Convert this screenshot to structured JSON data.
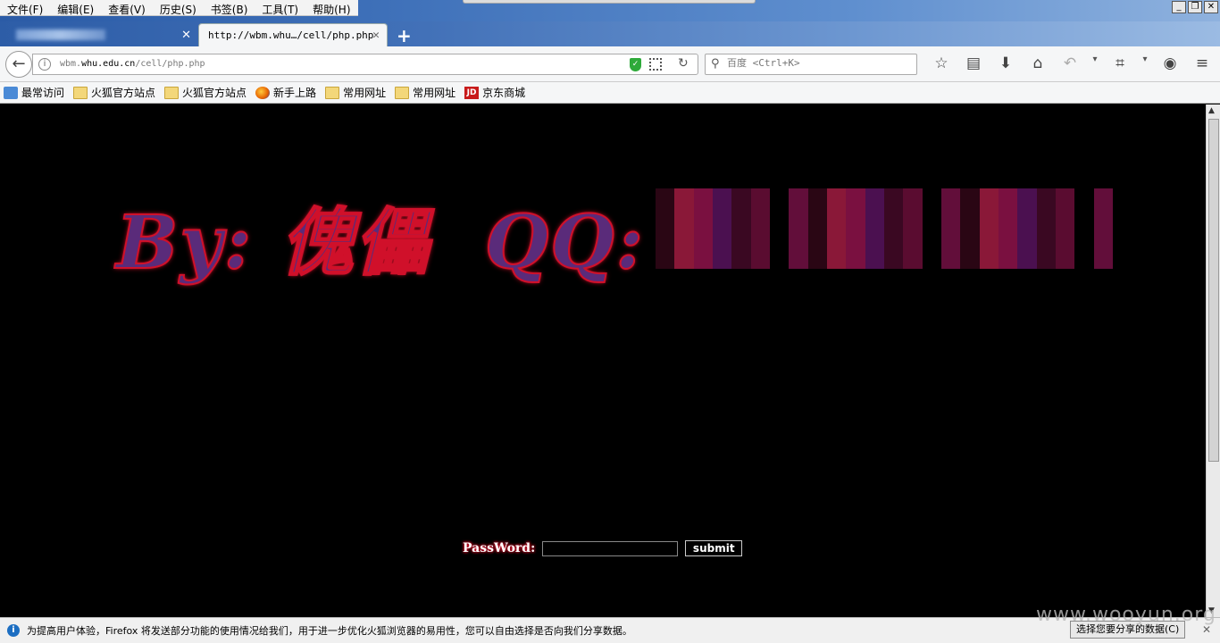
{
  "menu": [
    "文件(F)",
    "编辑(E)",
    "查看(V)",
    "历史(S)",
    "书签(B)",
    "工具(T)",
    "帮助(H)"
  ],
  "window_controls": [
    "_",
    "❐",
    "✕"
  ],
  "tabs": {
    "inactive_close": "✕",
    "active_title": "http://wbm.whu…/cell/php.php",
    "active_close": "✕",
    "new_tab": "+"
  },
  "nav": {
    "back": "←",
    "url_prefix": "wbm.",
    "url_domain": "whu.edu.cn",
    "url_path": "/cell/php.php",
    "search_placeholder": "百度 <Ctrl+K>"
  },
  "toolbar_icons": [
    "bookmark-star-icon",
    "reading-list-icon",
    "download-icon",
    "home-icon",
    "undo-icon",
    "dropdown-icon",
    "crop-icon",
    "dropdown-icon",
    "chat-icon",
    "menu-icon"
  ],
  "bookmarks": [
    {
      "label": "最常访问",
      "icon": "most-visited-icon"
    },
    {
      "label": "火狐官方站点",
      "icon": "folder-icon"
    },
    {
      "label": "火狐官方站点",
      "icon": "folder-icon"
    },
    {
      "label": "新手上路",
      "icon": "firefox-icon"
    },
    {
      "label": "常用网址",
      "icon": "folder-icon"
    },
    {
      "label": "常用网址",
      "icon": "folder-icon"
    },
    {
      "label": "京东商城",
      "icon": "jd-icon",
      "badge": "JD"
    }
  ],
  "page": {
    "banner": "By: 傀儡  QQ:",
    "password_label": "PassWord:",
    "submit_label": "submit"
  },
  "notification": {
    "message": "为提高用户体验，Firefox 将发送部分功能的使用情况给我们，用于进一步优化火狐浏览器的易用性，您可以自由选择是否向我们分享数据。",
    "button": "选择您要分享的数据(C)",
    "close": "✕"
  },
  "watermark": "www.wooyun.org",
  "colors": {
    "banner_fill": "#5a2b7a",
    "banner_glow": "#d0102a",
    "page_bg": "#000000"
  }
}
